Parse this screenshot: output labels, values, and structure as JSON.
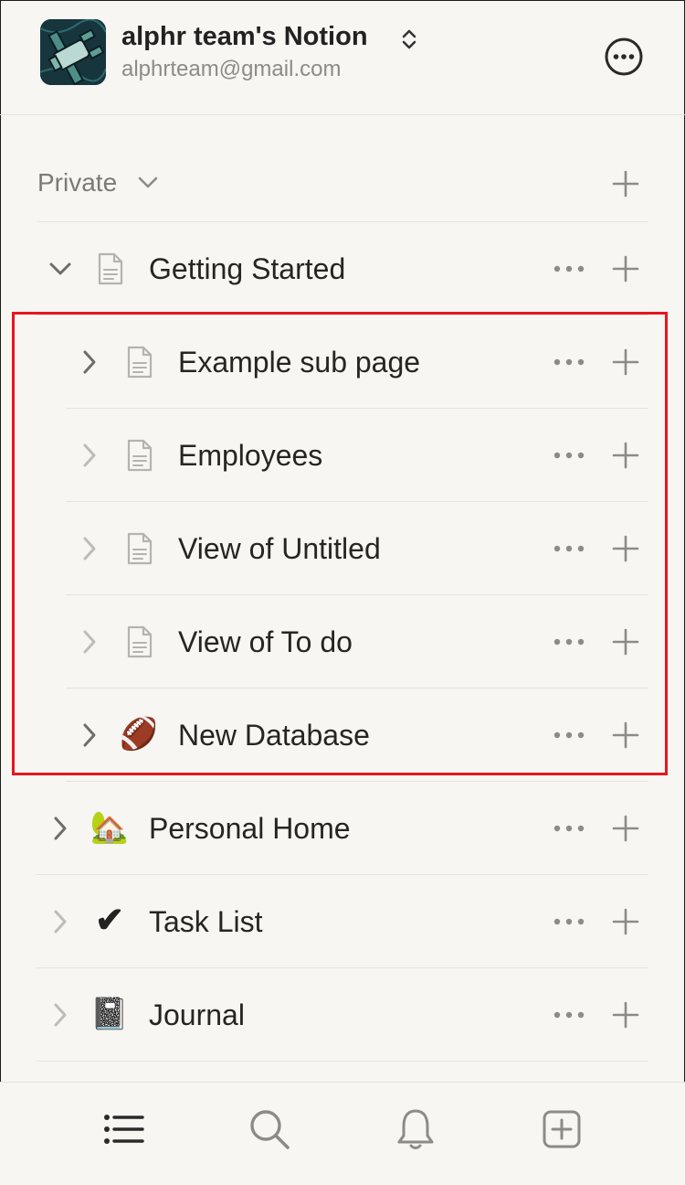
{
  "workspace": {
    "name": "alphr team's Notion",
    "email": "alphrteam@gmail.com",
    "avatar_icon": "telescope-satellite-icon"
  },
  "section": {
    "label": "Private"
  },
  "pages": [
    {
      "label": "Getting Started",
      "icon": "page-icon",
      "expanded": true,
      "level": 0
    },
    {
      "label": "Example sub page",
      "icon": "page-icon",
      "level": 1
    },
    {
      "label": "Employees",
      "icon": "page-icon",
      "level": 1
    },
    {
      "label": "View of Untitled",
      "icon": "page-icon",
      "level": 1
    },
    {
      "label": "View of To do",
      "icon": "page-icon",
      "level": 1
    },
    {
      "label": "New Database",
      "icon": "football-emoji",
      "emoji": "🏈",
      "level": 1
    },
    {
      "label": "Personal Home",
      "icon": "house-emoji",
      "emoji": "🏡",
      "level": 0
    },
    {
      "label": "Task List",
      "icon": "check-mark-emoji",
      "emoji": "✔",
      "level": 0
    },
    {
      "label": "Journal",
      "icon": "notebook-emoji",
      "emoji": "📓",
      "level": 0
    }
  ],
  "tabbar": [
    "list-icon",
    "search-icon",
    "bell-icon",
    "new-page-icon"
  ],
  "colors": {
    "background": "#f7f6f3",
    "highlight": "#e6161f",
    "text": "#37352f",
    "muted": "#8d8b86"
  }
}
